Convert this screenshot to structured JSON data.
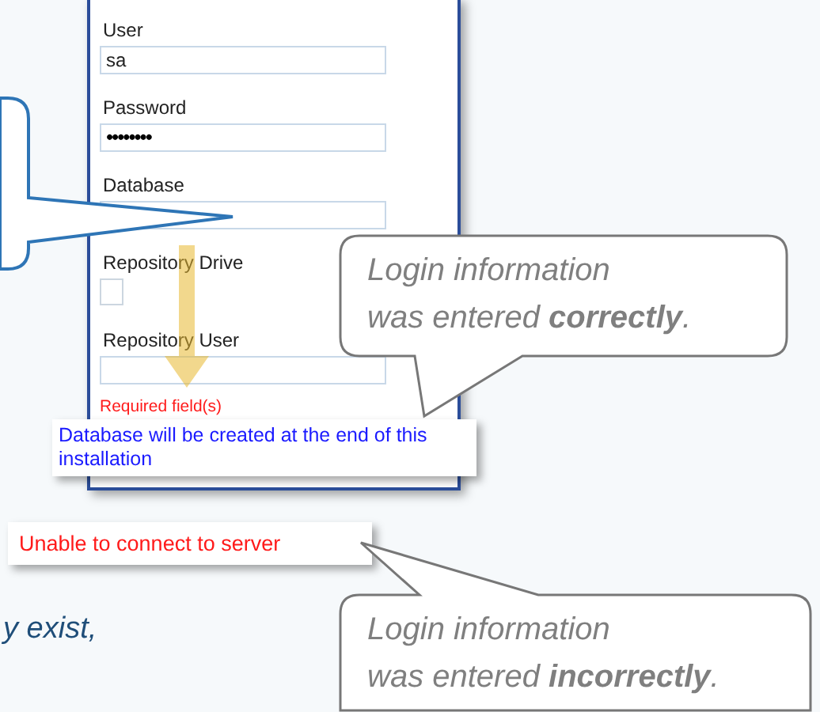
{
  "form": {
    "fields": [
      {
        "kind": "text",
        "label": "User",
        "value": "sa"
      },
      {
        "kind": "password",
        "label": "Password",
        "value": "••••••••"
      },
      {
        "kind": "text",
        "label": "Database"
      },
      {
        "kind": "checkbox",
        "label": "Repository Drive",
        "checked": false
      },
      {
        "kind": "text",
        "label": "Repository User"
      }
    ],
    "validation": "Required field(s)"
  },
  "info_message": "Database will be created at the end of this installation",
  "error_message": "Unable to connect to server",
  "callouts": [
    {
      "lines": [
        "Login information",
        "was entered **correctly**."
      ]
    },
    {
      "lines": [
        "Login information",
        "was entered **incorrectly**."
      ]
    }
  ],
  "body_text": "y exist,"
}
